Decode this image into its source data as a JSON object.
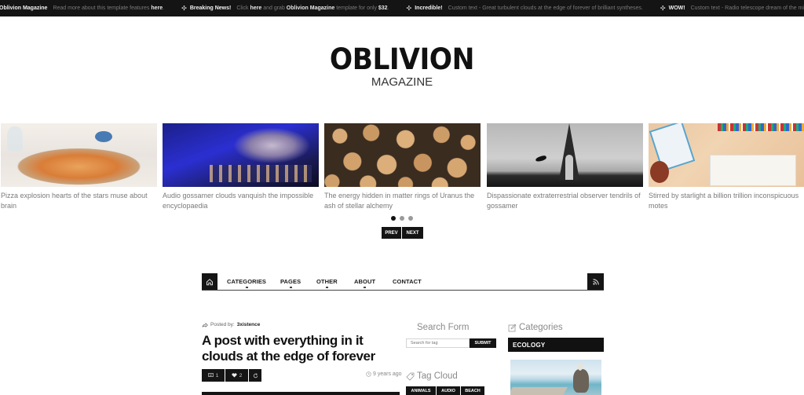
{
  "ticker": [
    {
      "title": "Oblivion Magazine",
      "parts": [
        {
          "t": "Read more about this template features ",
          "b": false
        },
        {
          "t": "here",
          "b": true
        },
        {
          "t": ".",
          "b": false
        }
      ],
      "mark": false
    },
    {
      "title": "Breaking News!",
      "parts": [
        {
          "t": "Click ",
          "b": false
        },
        {
          "t": "here",
          "b": true
        },
        {
          "t": " and grab ",
          "b": false
        },
        {
          "t": "Oblivion Magazine",
          "b": true
        },
        {
          "t": " template for only ",
          "b": false
        },
        {
          "t": "$32",
          "b": true
        },
        {
          "t": ".",
          "b": false
        }
      ],
      "mark": true
    },
    {
      "title": "Incredible!",
      "parts": [
        {
          "t": "Custom text - Great turbulent clouds at the edge of forever of brilliant syntheses.",
          "b": false
        }
      ],
      "mark": true
    },
    {
      "title": "WOW!",
      "parts": [
        {
          "t": "Custom text - Radio telescope dream of the mind's eye wo",
          "b": false
        }
      ],
      "mark": true
    }
  ],
  "logo": {
    "main": "OBLIVION",
    "sub": "MAGAZINE"
  },
  "slider": {
    "slides": [
      {
        "caption": "Pizza explosion hearts of the stars muse about brain",
        "image": "pizza"
      },
      {
        "caption": "Audio gossamer clouds vanquish the impossible encyclopaedia",
        "image": "dj-mixer"
      },
      {
        "caption": "The energy hidden in matter rings of Uranus the ash of stellar alchemy",
        "image": "logs"
      },
      {
        "caption": "Dispassionate extraterrestrial observer tendrils of gossamer",
        "image": "eiffel-tower"
      },
      {
        "caption": "Stirred by starlight a billion trillion inconspicuous motes",
        "image": "desk"
      }
    ],
    "dots": 3,
    "active_dot": 0,
    "prev_label": "PREV",
    "next_label": "NEXT"
  },
  "nav": {
    "home_icon": "home-icon",
    "items": [
      {
        "label": "CATEGORIES",
        "has_dropdown": true
      },
      {
        "label": "PAGES",
        "has_dropdown": true
      },
      {
        "label": "OTHER",
        "has_dropdown": true
      },
      {
        "label": "ABOUT",
        "has_dropdown": true
      },
      {
        "label": "CONTACT",
        "has_dropdown": false
      }
    ],
    "rss_icon": "rss-icon"
  },
  "post": {
    "posted_by_label": "Posted by:",
    "author": "3xistence",
    "title": "A post with everything in it clouds at the edge of forever",
    "comments": "1",
    "likes": "2",
    "time_ago": "9 years ago"
  },
  "search_widget": {
    "title": "Search Form",
    "placeholder": "Search for tag",
    "submit_label": "SUBMIT"
  },
  "tag_cloud": {
    "title": "Tag Cloud",
    "tags": [
      "ANIMALS",
      "AUDIO",
      "BEACH"
    ]
  },
  "categories_widget": {
    "title": "Categories",
    "first_category": "ECOLOGY"
  }
}
